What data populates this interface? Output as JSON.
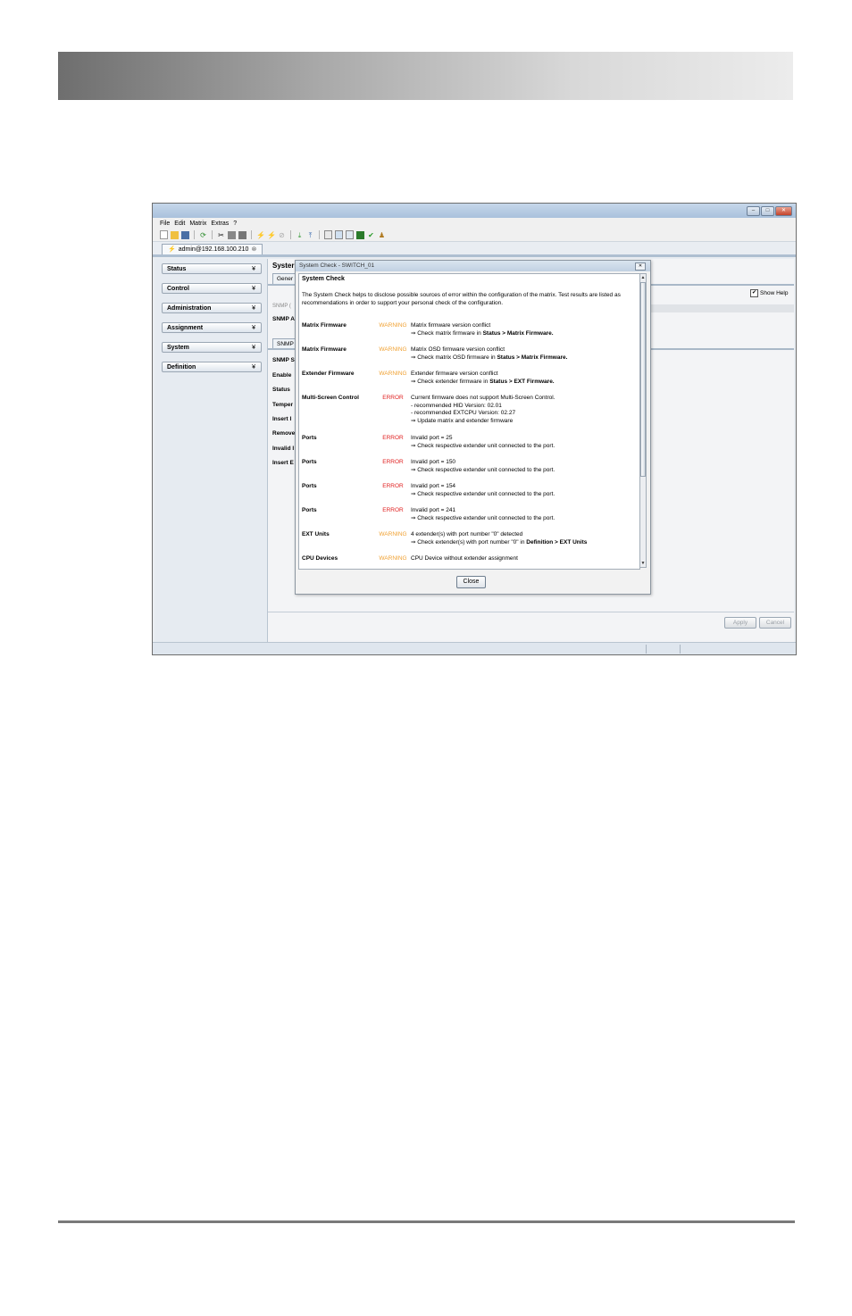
{
  "app": {
    "connection_tab": "admin@192.168.100.210"
  },
  "menu": [
    "File",
    "Edit",
    "Matrix",
    "Extras",
    "?"
  ],
  "sidebar": {
    "items": [
      {
        "label": "Status"
      },
      {
        "label": "Control"
      },
      {
        "label": "Administration"
      },
      {
        "label": "Assignment"
      },
      {
        "label": "System"
      },
      {
        "label": "Definition"
      }
    ]
  },
  "main": {
    "title": "Syster",
    "tab_general": "Gener",
    "tab_snmp": "SNMP",
    "grey_label": "SNMP (",
    "labels": [
      "SNMP A",
      "SNMP S",
      "Enable",
      "Status",
      "Temper",
      "Insert I",
      "Remove",
      "Invalid I",
      "Insert E"
    ],
    "show_help": "Show Help",
    "apply": "Apply",
    "cancel": "Cancel"
  },
  "dialog": {
    "title": "System Check - SWITCH_01",
    "heading": "System Check",
    "intro": "The System Check helps to disclose possible sources of error within the configuration of the matrix. Test results are listed as recommendations in order to support your personal check of the configuration.",
    "rows": [
      {
        "name": "Matrix Firmware",
        "severity": "WARNING",
        "line1": "Matrix firmware version conflict",
        "line2_pre": "⇒ Check matrix firmware in ",
        "line2_bold": "Status > Matrix Firmware."
      },
      {
        "name": "Matrix Firmware",
        "severity": "WARNING",
        "line1": "Matrix OSD firmware version conflict",
        "line2_pre": "⇒ Check matrix OSD firmware in ",
        "line2_bold": "Status > Matrix Firmware."
      },
      {
        "name": "Extender Firmware",
        "severity": "WARNING",
        "line1": "Extender firmware version conflict",
        "line2_pre": "⇒ Check extender firmware in ",
        "line2_bold": "Status > EXT Firmware."
      },
      {
        "name": "Multi-Screen Control",
        "severity": "ERROR",
        "line1": "Current firmware does not support Multi-Screen Control.",
        "line2": "- recommended HID Version: 02.01",
        "line3": "- recommended EXTCPU Version: 02.27",
        "line4": "⇒ Update matrix and extender firmware"
      },
      {
        "name": "Ports",
        "severity": "ERROR",
        "line1": "Invalid port = 25",
        "line2": "⇒ Check respective extender unit connected to the port."
      },
      {
        "name": "Ports",
        "severity": "ERROR",
        "line1": "Invalid port = 150",
        "line2": "⇒ Check respective extender unit connected to the port."
      },
      {
        "name": "Ports",
        "severity": "ERROR",
        "line1": "Invalid port = 154",
        "line2": "⇒ Check respective extender unit connected to the port."
      },
      {
        "name": "Ports",
        "severity": "ERROR",
        "line1": "Invalid port = 241",
        "line2": "⇒ Check respective extender unit connected to the port."
      },
      {
        "name": "EXT Units",
        "severity": "WARNING",
        "line1": "4 extender(s) with port number \"0\" detected",
        "line2_pre": "⇒ Check extender(s) with port number \"0\" in ",
        "line2_bold": "Definition > EXT Units"
      },
      {
        "name": "CPU Devices",
        "severity": "WARNING",
        "line1": "CPU Device without extender assignment"
      }
    ],
    "close_button": "Close"
  },
  "colors": {
    "warning": "#f0a030",
    "error": "#e02020"
  }
}
